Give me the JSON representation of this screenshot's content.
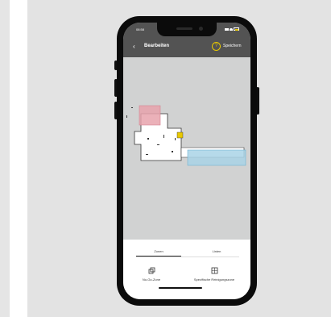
{
  "status_bar": {
    "time": "08:58"
  },
  "toolbar": {
    "back_icon": "chevron-left-icon",
    "title": "Bearbeiten",
    "help_icon": "question-circle-icon",
    "save_label": "Speichern"
  },
  "map": {
    "no_go_zone_color": "#e8a3ad",
    "cleaning_zone_color": "#a9d3e6",
    "dock_color": "#e8c800"
  },
  "tabs": [
    {
      "label": "Zonen",
      "active": true
    },
    {
      "label": "Linien",
      "active": false
    }
  ],
  "actions": [
    {
      "label": "No-Go-Zone",
      "icon": "no-go-zone-icon"
    },
    {
      "label": "Spezifische Reinigungszone",
      "icon": "cleaning-zone-icon"
    }
  ],
  "colors": {
    "panel_background": "#e3e3e3",
    "phone_frame": "#0b0b0b",
    "toolbar_background": "#535353",
    "accent": "#e8c800"
  }
}
